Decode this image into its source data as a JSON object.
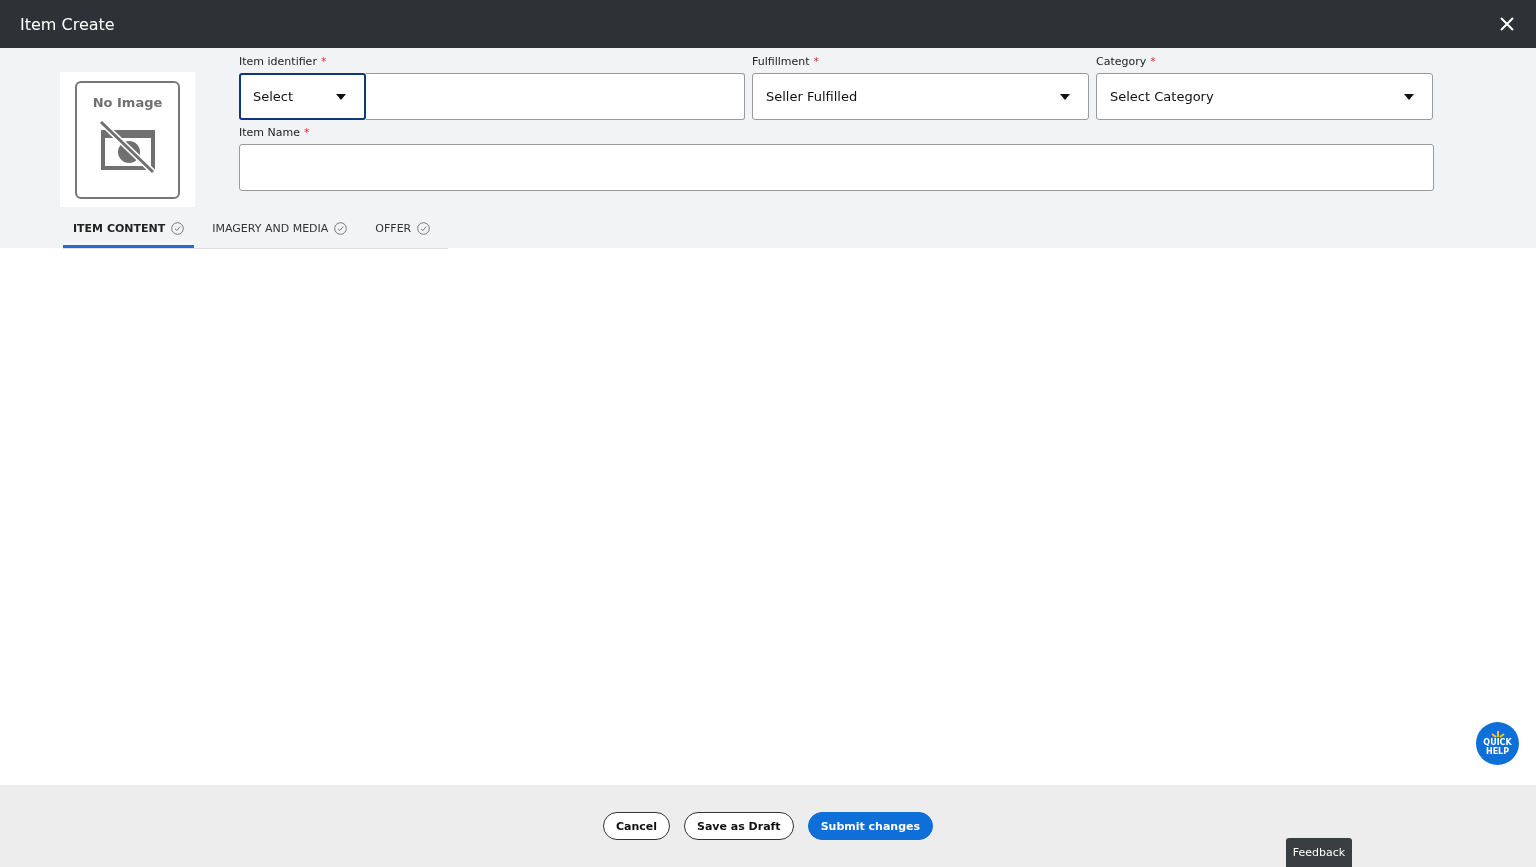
{
  "window": {
    "title": "Item Create"
  },
  "image": {
    "placeholder_text": "No Image"
  },
  "fields": {
    "identifier": {
      "label": "Item identifier",
      "required_mark": "*",
      "type_value": "Select",
      "focused": true
    },
    "fulfillment": {
      "label": "Fulfillment",
      "required_mark": "*",
      "value": "Seller Fulfilled"
    },
    "category": {
      "label": "Category",
      "required_mark": "*",
      "value": "Select Category"
    },
    "item_name": {
      "label": "Item Name",
      "required_mark": "*"
    }
  },
  "tabs": [
    {
      "label": "ITEM CONTENT",
      "selected": true
    },
    {
      "label": "IMAGERY AND MEDIA",
      "selected": false
    },
    {
      "label": "OFFER",
      "selected": false
    }
  ],
  "buttons": [
    {
      "label": "Cancel",
      "kind": "outline"
    },
    {
      "label": "Save as Draft",
      "kind": "outline"
    },
    {
      "label": "Submit changes",
      "kind": "primary"
    }
  ],
  "quick_help": {
    "line_1": "QUICK",
    "line_2": "HELP"
  },
  "feedback": "Feedback"
}
